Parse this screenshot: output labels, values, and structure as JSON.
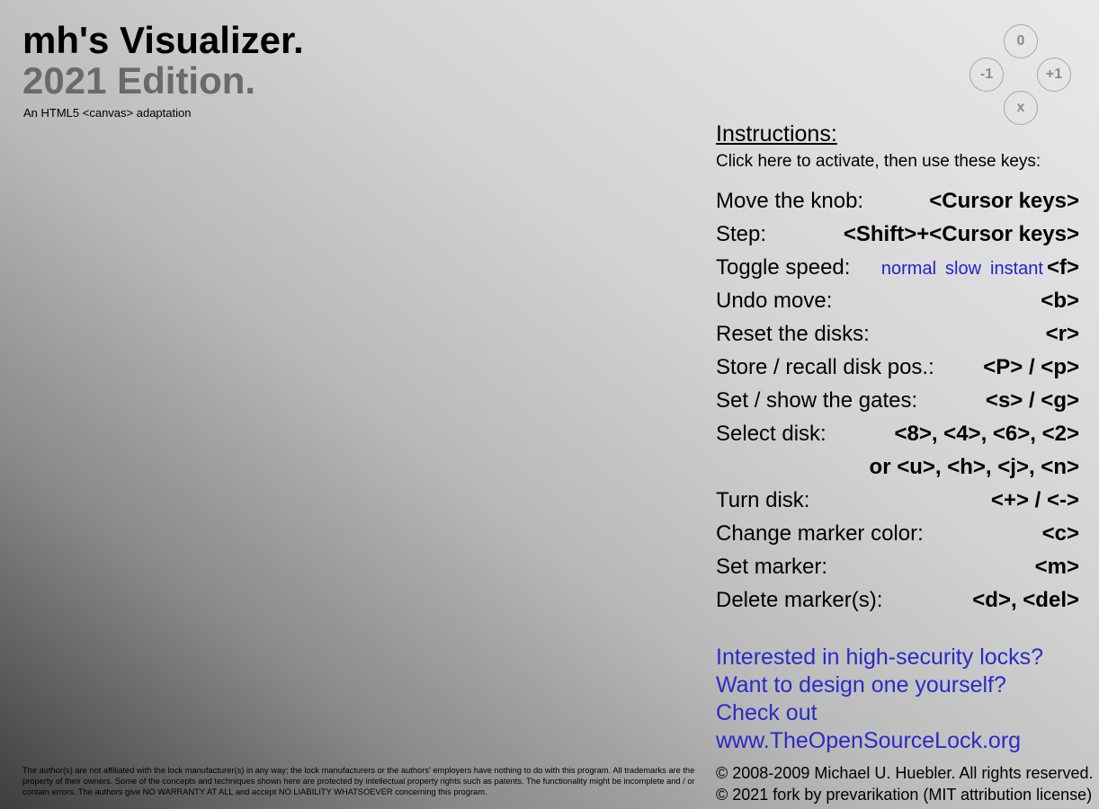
{
  "header": {
    "title": "mh's Visualizer.",
    "subtitle": "2021 Edition.",
    "tagline": "An HTML5 <canvas> adaptation"
  },
  "nav_buttons": {
    "up": "0",
    "left": "-1",
    "right": "+1",
    "down": "x"
  },
  "instructions": {
    "heading": "Instructions:",
    "activate": "Click here to activate, then use these keys:",
    "rows": [
      {
        "label": "Move the knob:",
        "key": "<Cursor keys>"
      },
      {
        "label": "Step:",
        "key": "<Shift>+<Cursor keys>"
      },
      {
        "label": "Toggle speed:",
        "key": "<f>",
        "speeds": [
          "normal",
          "slow",
          "instant"
        ]
      },
      {
        "label": "Undo move:",
        "key": "<b>"
      },
      {
        "label": "Reset the disks:",
        "key": "<r>"
      },
      {
        "label": "Store / recall disk pos.:",
        "key": "<P> / <p>"
      },
      {
        "label": "Set / show the gates:",
        "key": "<s> / <g>"
      },
      {
        "label": "Select disk:",
        "key": "<8>, <4>, <6>, <2>"
      },
      {
        "label": "",
        "key": "or <u>, <h>, <j>, <n>"
      },
      {
        "label": "Turn disk:",
        "key": "<+> / <->"
      },
      {
        "label": "Change marker color:",
        "key": "<c>"
      },
      {
        "label": "Set marker:",
        "key": "<m>"
      },
      {
        "label": "Delete marker(s):",
        "key": "<d>, <del>"
      }
    ]
  },
  "promo": {
    "line1": "Interested in high-security locks?",
    "line2": "Want to design one yourself?",
    "line3": "Check out",
    "line4": "www.TheOpenSourceLock.org"
  },
  "copyright": {
    "line1": "© 2008-2009 Michael U. Huebler. All rights reserved.",
    "line2": "© 2021 fork by prevarikation (MIT attribution license)"
  },
  "disclaimer": "The author(s) are not affiliated with the lock manufacturer(s) in any way; the lock manufacturers or the authors' employers have nothing to do with this program. All trademarks are the property of their owners. Some of the concepts and techniques shown here are protected by intellectual property rights such as patents. The functionality might be incomplete and / or contain errors. The authors give NO WARRANTY AT ALL and accept NO LIABILITY WHATSOEVER concerning this program."
}
